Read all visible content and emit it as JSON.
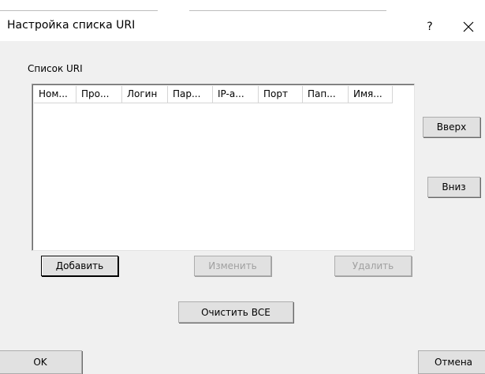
{
  "dialog": {
    "title": "Настройка списка URI",
    "help_label": "?"
  },
  "group": {
    "label": "Список URI"
  },
  "list": {
    "columns": [
      "Ном...",
      "Про...",
      "Логин",
      "Пар...",
      "IP-а...",
      "Порт",
      "Пап...",
      "Имя..."
    ],
    "rows": []
  },
  "buttons": {
    "up": "Вверх",
    "down": "Вниз",
    "add": "Добавить",
    "edit": "Изменить",
    "delete": "Удалить",
    "clear_all": "Очистить ВСЕ",
    "ok": "OK",
    "cancel": "Отмена"
  },
  "icons": {
    "close": "close-icon"
  }
}
